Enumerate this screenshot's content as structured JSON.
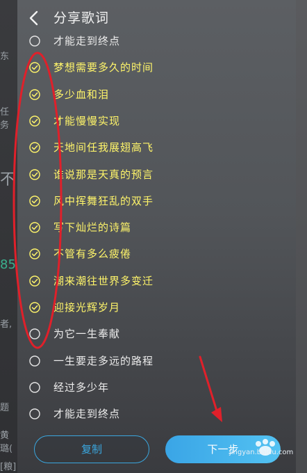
{
  "header": {
    "title": "分享歌词",
    "back_icon": "chevron-left-icon"
  },
  "lyrics": [
    {
      "text": "才能走到终点",
      "checked": false
    },
    {
      "text": "梦想需要多久的时间",
      "checked": true
    },
    {
      "text": "多少血和泪",
      "checked": true
    },
    {
      "text": "才能慢慢实现",
      "checked": true
    },
    {
      "text": "天地间任我展翅高飞",
      "checked": true
    },
    {
      "text": "谁说那是天真的预言",
      "checked": true
    },
    {
      "text": "风中挥舞狂乱的双手",
      "checked": true
    },
    {
      "text": "写下灿烂的诗篇",
      "checked": true
    },
    {
      "text": "不管有多么疲倦",
      "checked": true
    },
    {
      "text": "潮来潮往世界多变迁",
      "checked": true
    },
    {
      "text": "迎接光辉岁月",
      "checked": true
    },
    {
      "text": "为它一生奉献",
      "checked": false
    },
    {
      "text": "一生要走多远的路程",
      "checked": false
    },
    {
      "text": "经过多少年",
      "checked": false
    },
    {
      "text": "才能走到终点",
      "checked": false
    }
  ],
  "buttons": {
    "copy": "复制",
    "next": "下一步"
  },
  "watermark": {
    "text": "jingyan.baidu.com",
    "logo": "Bai du"
  },
  "colors": {
    "checked_text": "#fff56a",
    "accent": "#3aa7df",
    "annotation": "#e0202a"
  }
}
